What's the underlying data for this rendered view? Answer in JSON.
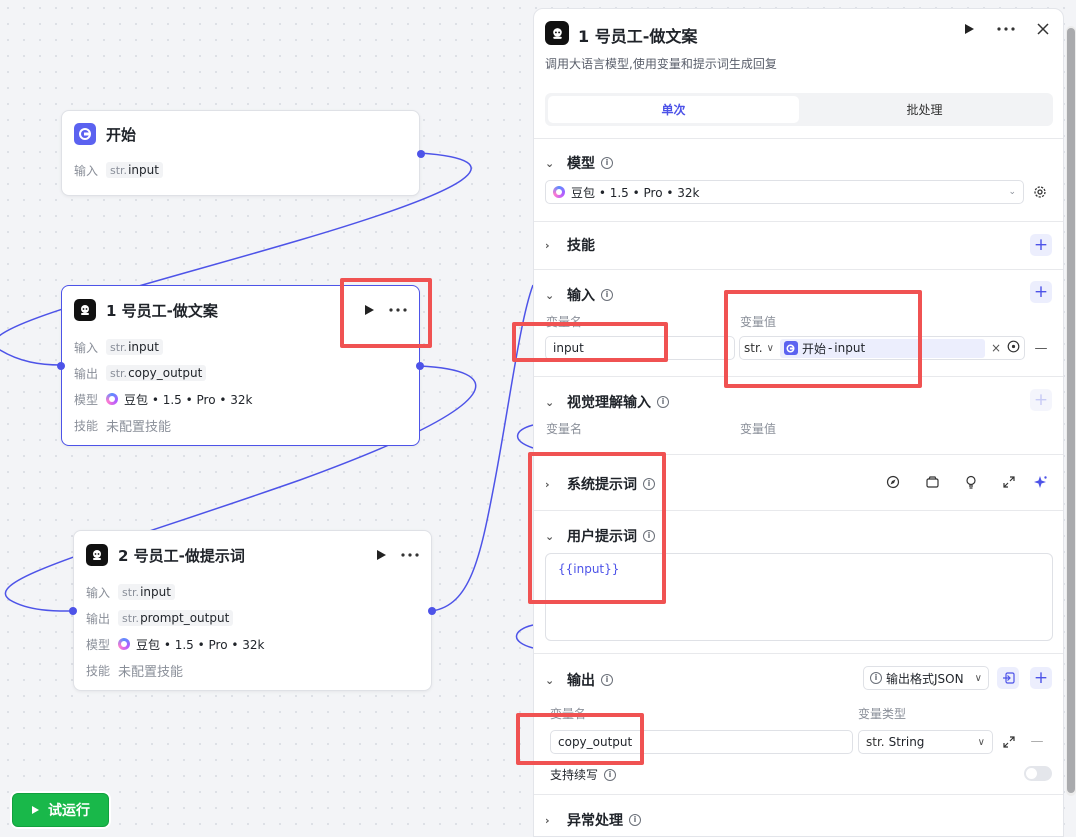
{
  "canvas": {
    "start_node": {
      "title": "开始",
      "rows": [
        {
          "key": "输入",
          "type": "str.",
          "value": "input"
        }
      ]
    },
    "node1": {
      "title": "1 号员工-做文案",
      "rows": [
        {
          "key": "输入",
          "type": "str.",
          "value": "input"
        },
        {
          "key": "输出",
          "type": "str.",
          "value": "copy_output"
        }
      ],
      "model_label": "模型",
      "model_value": "豆包 • 1.5 • Pro • 32k",
      "skill_label": "技能",
      "skill_value": "未配置技能"
    },
    "node2": {
      "title": "2 号员工-做提示词",
      "rows": [
        {
          "key": "输入",
          "type": "str.",
          "value": "input"
        },
        {
          "key": "输出",
          "type": "str.",
          "value": "prompt_output"
        }
      ],
      "model_label": "模型",
      "model_value": "豆包 • 1.5 • Pro • 32k",
      "skill_label": "技能",
      "skill_value": "未配置技能"
    },
    "run_button": "试运行"
  },
  "panel": {
    "title": "1 号员工-做文案",
    "subtitle": "调用大语言模型,使用变量和提示词生成回复",
    "tabs": [
      "单次",
      "批处理"
    ],
    "active_tab": "单次",
    "sections": {
      "model": {
        "label": "模型",
        "value": "豆包 • 1.5 • Pro • 32k"
      },
      "skills": {
        "label": "技能"
      },
      "input": {
        "label": "输入",
        "col_name": "变量名",
        "col_value": "变量值",
        "var_name": "input",
        "var_type": "str.",
        "ref_node": "开始",
        "ref_sep": "-",
        "ref_var": "input"
      },
      "vision": {
        "label": "视觉理解输入",
        "col_name": "变量名",
        "col_value": "变量值"
      },
      "system_prompt": {
        "label": "系统提示词"
      },
      "user_prompt": {
        "label": "用户提示词",
        "content": "{{input}}"
      },
      "output": {
        "label": "输出",
        "format": "输出格式JSON",
        "col_name": "变量名",
        "col_type": "变量类型",
        "var_name": "copy_output",
        "var_type_prefix": "str.",
        "var_type": "String",
        "continue_label": "支持续写",
        "continue_enabled": false
      },
      "error": {
        "label": "异常处理"
      }
    }
  },
  "colors": {
    "accent": "#4d53e8",
    "run_green": "#19b84a",
    "highlight": "#f05252"
  }
}
